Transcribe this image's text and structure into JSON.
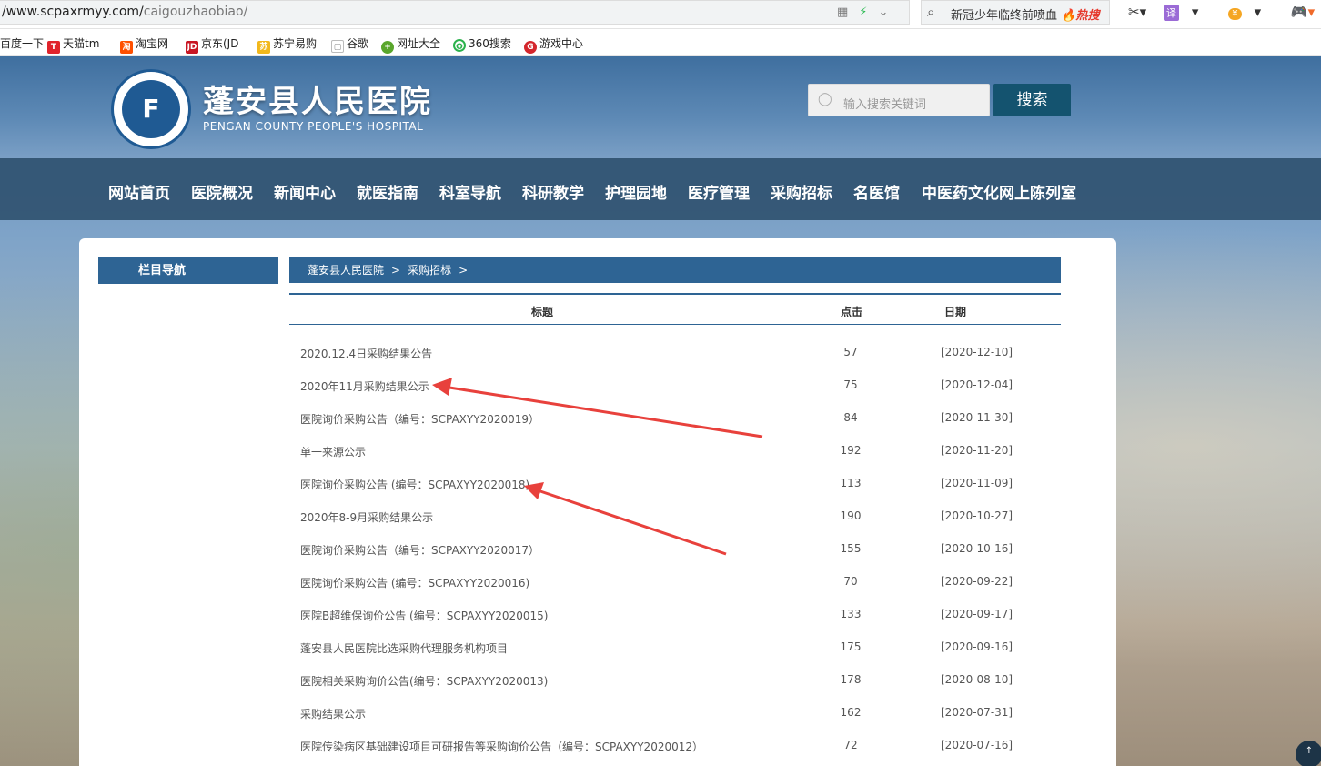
{
  "browser": {
    "url_host": "/www.scpaxrmyy.com/",
    "url_path": "caigouzhaobiao/",
    "hot_search_text": "新冠少年临终前喷血",
    "hot_search_badge": "🔥热搜",
    "tools": {
      "cut": "✂▾",
      "translate": "译",
      "translate_arrow": "▾",
      "coin": "¥",
      "coin_arrow": "▾",
      "game": "🎮▾",
      "zoom": "🔍"
    },
    "bookmarks": [
      {
        "label": "百度一下",
        "icon": ""
      },
      {
        "label": "天猫tm",
        "icon": "T"
      },
      {
        "label": "淘宝网",
        "icon": "淘"
      },
      {
        "label": "京东(JD",
        "icon": "JD"
      },
      {
        "label": "苏宁易购",
        "icon": "苏"
      },
      {
        "label": "谷歌",
        "icon": "▢"
      },
      {
        "label": "网址大全",
        "icon": "+"
      },
      {
        "label": "360搜索",
        "icon": "O"
      },
      {
        "label": "游戏中心",
        "icon": "G"
      }
    ]
  },
  "site": {
    "logo_mark": "F",
    "name_cn": "蓬安县人民医院",
    "name_en": "PENGAN COUNTY PEOPLE'S HOSPITAL",
    "search_placeholder": "输入搜索关键词",
    "search_button": "搜索",
    "nav": [
      "网站首页",
      "医院概况",
      "新闻中心",
      "就医指南",
      "科室导航",
      "科研教学",
      "护理园地",
      "医疗管理",
      "采购招标",
      "名医馆",
      "中医药文化网上陈列室"
    ]
  },
  "sidebar": {
    "title": "栏目导航"
  },
  "breadcrumb": [
    "蓬安县人民医院",
    ">",
    "采购招标",
    ">"
  ],
  "table": {
    "headers": {
      "title": "标题",
      "clicks": "点击",
      "date": "日期"
    },
    "rows": [
      {
        "title": "2020.12.4日采购结果公告",
        "clicks": "57",
        "date": "[2020-12-10]"
      },
      {
        "title": "2020年11月采购结果公示",
        "clicks": "75",
        "date": "[2020-12-04]"
      },
      {
        "title": "医院询价采购公告（编号：SCPAXYY2020019）",
        "clicks": "84",
        "date": "[2020-11-30]"
      },
      {
        "title": "单一来源公示",
        "clicks": "192",
        "date": "[2020-11-20]"
      },
      {
        "title": "医院询价采购公告 (编号：SCPAXYY2020018)",
        "clicks": "113",
        "date": "[2020-11-09]"
      },
      {
        "title": "2020年8-9月采购结果公示",
        "clicks": "190",
        "date": "[2020-10-27]"
      },
      {
        "title": "医院询价采购公告（编号：SCPAXYY2020017）",
        "clicks": "155",
        "date": "[2020-10-16]"
      },
      {
        "title": "医院询价采购公告 (编号：SCPAXYY2020016)",
        "clicks": "70",
        "date": "[2020-09-22]"
      },
      {
        "title": "医院B超维保询价公告 (编号：SCPAXYY2020015)",
        "clicks": "133",
        "date": "[2020-09-17]"
      },
      {
        "title": "蓬安县人民医院比选采购代理服务机构项目",
        "clicks": "175",
        "date": "[2020-09-16]"
      },
      {
        "title": "医院相关采购询价公告(编号：SCPAXYY2020013)",
        "clicks": "178",
        "date": "[2020-08-10]"
      },
      {
        "title": "采购结果公示",
        "clicks": "162",
        "date": "[2020-07-31]"
      },
      {
        "title": "医院传染病区基础建设项目可研报告等采购询价公告（编号：SCPAXYY2020012）",
        "clicks": "72",
        "date": "[2020-07-16]"
      }
    ]
  },
  "annotation_color": "#e8413c",
  "back_to_top": "↑"
}
